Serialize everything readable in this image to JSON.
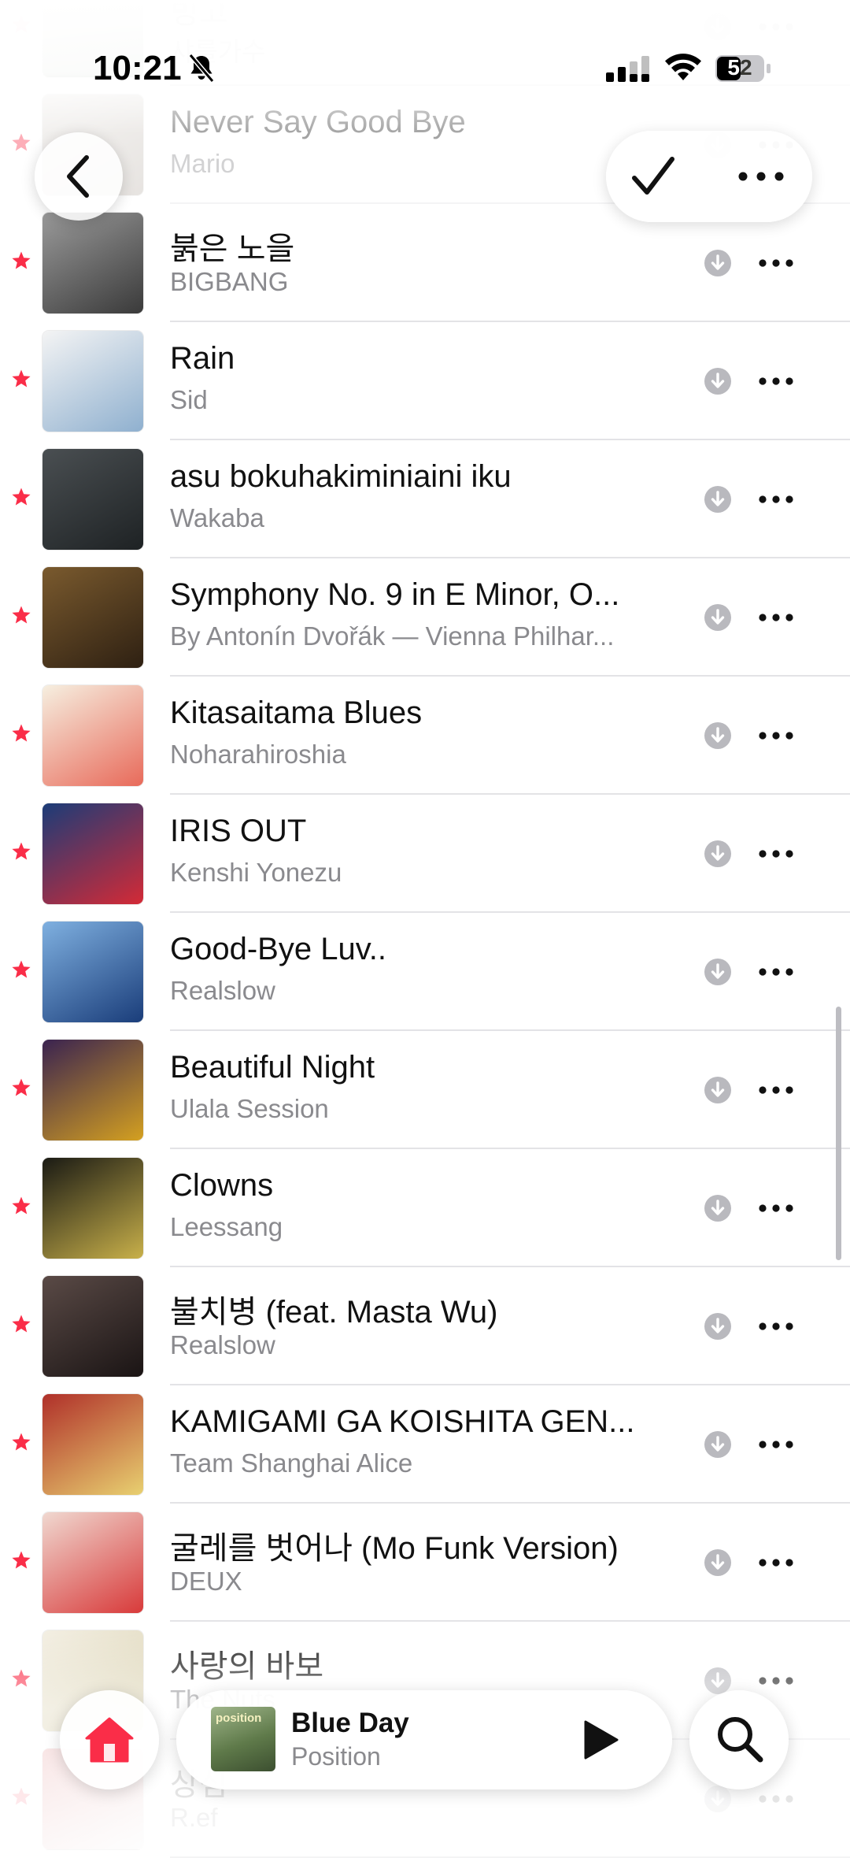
{
  "status_bar": {
    "time": "10:21",
    "battery": "52"
  },
  "colors": {
    "accent": "#fa2d48",
    "secondary_text": "#8a8a8e",
    "divider": "#e3e3e6"
  },
  "songs": [
    {
      "title": "빙고",
      "artist": "샤를가수",
      "art": [
        "#d9c8a0",
        "#4a6e5a"
      ],
      "faded": true
    },
    {
      "title": "Never Say Good Bye",
      "artist": "Mario",
      "art": [
        "#e8e4e0",
        "#c0b8b0"
      ],
      "faded": true
    },
    {
      "title": "붉은 노을",
      "artist": "BIGBANG",
      "art": [
        "#9a9a9a",
        "#3a3a3a"
      ]
    },
    {
      "title": "Rain",
      "artist": "Sid",
      "art": [
        "#f4f4f4",
        "#8fb0cf"
      ]
    },
    {
      "title": "asu bokuhakiminiaini iku",
      "artist": "Wakaba",
      "art": [
        "#4a4f52",
        "#1e2224"
      ]
    },
    {
      "title": "Symphony No. 9 in E Minor, O...",
      "artist": "By Antonín Dvořák — Vienna Philhar...",
      "art": [
        "#7a5a2e",
        "#2e2012"
      ]
    },
    {
      "title": "Kitasaitama Blues",
      "artist": "Noharahiroshia",
      "art": [
        "#f6efe0",
        "#e86a5a"
      ]
    },
    {
      "title": "IRIS OUT",
      "artist": "Kenshi Yonezu",
      "art": [
        "#1b3c78",
        "#d42a36"
      ]
    },
    {
      "title": "Good-Bye Luv..",
      "artist": "Realslow",
      "art": [
        "#7fb0e0",
        "#1a3d7a"
      ]
    },
    {
      "title": "Beautiful Night",
      "artist": "Ulala Session",
      "art": [
        "#3a2350",
        "#d4a020"
      ]
    },
    {
      "title": "Clowns",
      "artist": "Leessang",
      "art": [
        "#1a1a14",
        "#c8b04a"
      ]
    },
    {
      "title": "불치병 (feat. Masta Wu)",
      "artist": "Realslow",
      "art": [
        "#5a4a46",
        "#1a1414"
      ]
    },
    {
      "title": "KAMIGAMI GA KOISHITA GEN...",
      "artist": "Team Shanghai Alice",
      "art": [
        "#b0302a",
        "#e8d070"
      ]
    },
    {
      "title": "굴레를 벗어나 (Mo Funk Version)",
      "artist": "DEUX",
      "art": [
        "#f0d8d0",
        "#d83a3a"
      ]
    },
    {
      "title": "사랑의 바보",
      "artist": "The Nuts",
      "art": [
        "#f2ede0",
        "#cfc59a"
      ]
    },
    {
      "title": "상심",
      "artist": "R.ef",
      "art": [
        "#d04040",
        "#f0f0f0"
      ],
      "faded": true
    }
  ],
  "now_playing": {
    "title": "Blue Day",
    "artist": "Position",
    "art_label": "position"
  },
  "icons": {
    "back": "chevron-left-icon",
    "check": "checkmark-icon",
    "more": "ellipsis-icon",
    "download": "download-icon",
    "favorite": "star-icon",
    "home": "home-icon",
    "play": "play-icon",
    "search": "search-icon"
  }
}
